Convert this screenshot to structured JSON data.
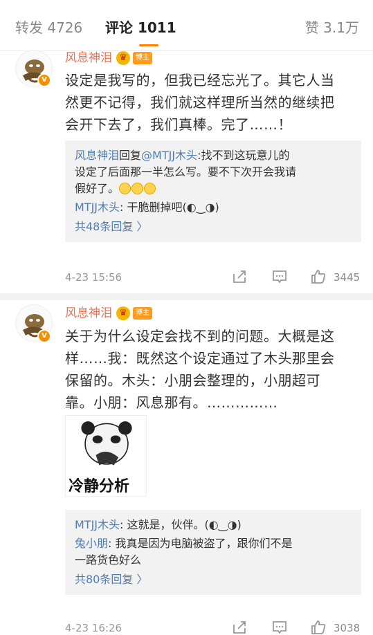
{
  "tabs": {
    "repost": "转发 4726",
    "comments": "评论 1011",
    "likes": "赞 3.1万"
  },
  "comments": [
    {
      "username": "风息神泪",
      "badge": "博主",
      "text_lines": [
        "设定是我写的，但我已经忘光了。其它人当",
        "然更不记得，我们就这样理所当然的继续把",
        "会开下去了，我们真棒。完了……！"
      ],
      "replies": [
        {
          "name": "风息神泪",
          "text_a": "回复",
          "mention": "@MTJJ木头",
          "text_b": ":找不到这玩意儿的",
          "line2": "设定了后面那一半怎么写。要不下次开会我请",
          "line3": "假好了。"
        },
        {
          "name": "MTJJ木头",
          "text": ": 干脆删掉吧(◐‿◑)"
        }
      ],
      "more": "共48条回复 〉",
      "time": "4-23 15:56",
      "likes": "3445"
    },
    {
      "username": "风息神泪",
      "badge": "博主",
      "text_lines": [
        "关于为什么设定会找不到的问题。大概是这",
        "样……我：既然这个设定通过了木头那里会",
        "保留的。木头：小朋会整理的，小朋超可",
        "靠。小朋：风息那有。……………"
      ],
      "sticker_caption": "冷静分析",
      "replies": [
        {
          "name": "MTJJ木头",
          "text": ": 这就是，伙伴。(◐‿◑)"
        },
        {
          "name": "兔小朋",
          "text": ": 我真是因为电脑被盗了，跟你们不是",
          "line2": "一路货色好么"
        }
      ],
      "more": "共80条回复 〉",
      "time": "4-23 16:26",
      "likes": "3038"
    }
  ],
  "icons": {
    "crown": "crown-icon",
    "share": "share-icon",
    "comment": "comment-icon",
    "like": "like-icon",
    "verified": "verified-icon"
  },
  "colors": {
    "username": "#eb7350",
    "link": "#507daf",
    "accent": "#ff8200"
  }
}
